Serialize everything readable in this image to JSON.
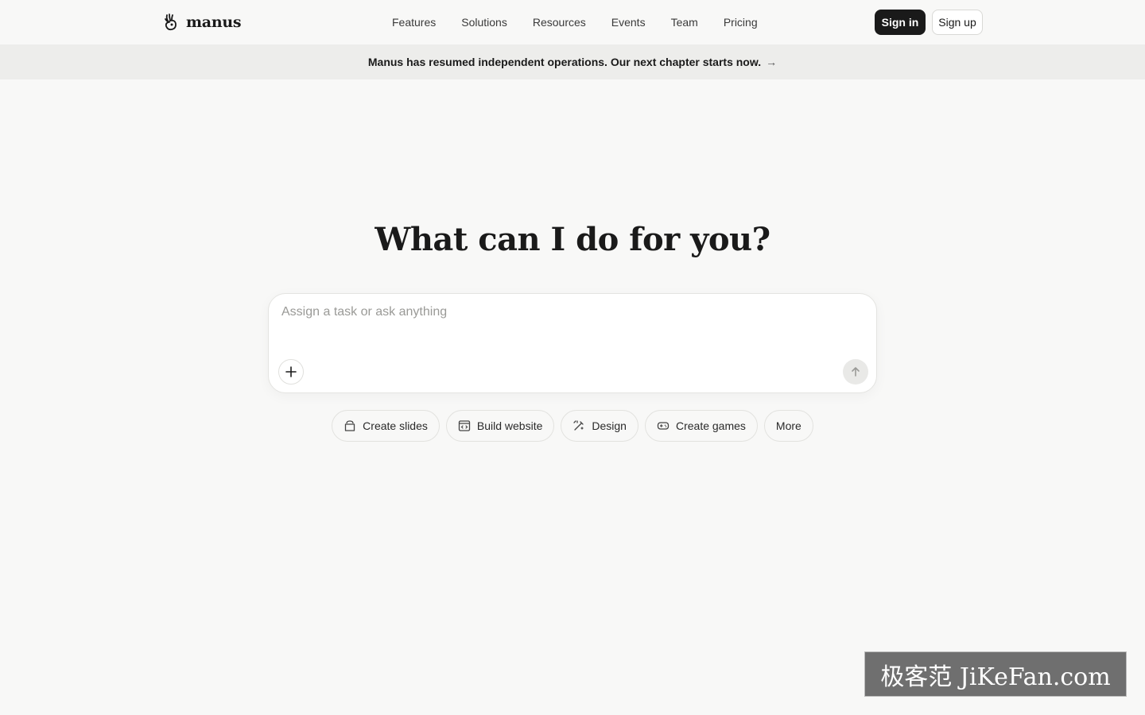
{
  "header": {
    "logo_text": "manus",
    "nav": [
      "Features",
      "Solutions",
      "Resources",
      "Events",
      "Team",
      "Pricing"
    ],
    "sign_in": "Sign in",
    "sign_up": "Sign up"
  },
  "banner": {
    "text": "Manus has resumed independent operations. Our next chapter starts now.",
    "arrow": "→"
  },
  "hero": {
    "title": "What can I do for you?",
    "placeholder": "Assign a task or ask anything"
  },
  "chips": [
    {
      "label": "Create slides",
      "icon": "slides-icon"
    },
    {
      "label": "Build website",
      "icon": "website-icon"
    },
    {
      "label": "Design",
      "icon": "design-icon"
    },
    {
      "label": "Create games",
      "icon": "gamepad-icon"
    },
    {
      "label": "More",
      "icon": ""
    }
  ],
  "watermark": "极客范 JiKeFan.com",
  "colors": {
    "background": "#f8f8f7",
    "primary_button": "#1a1a1a",
    "banner_bg": "#ededeb"
  }
}
